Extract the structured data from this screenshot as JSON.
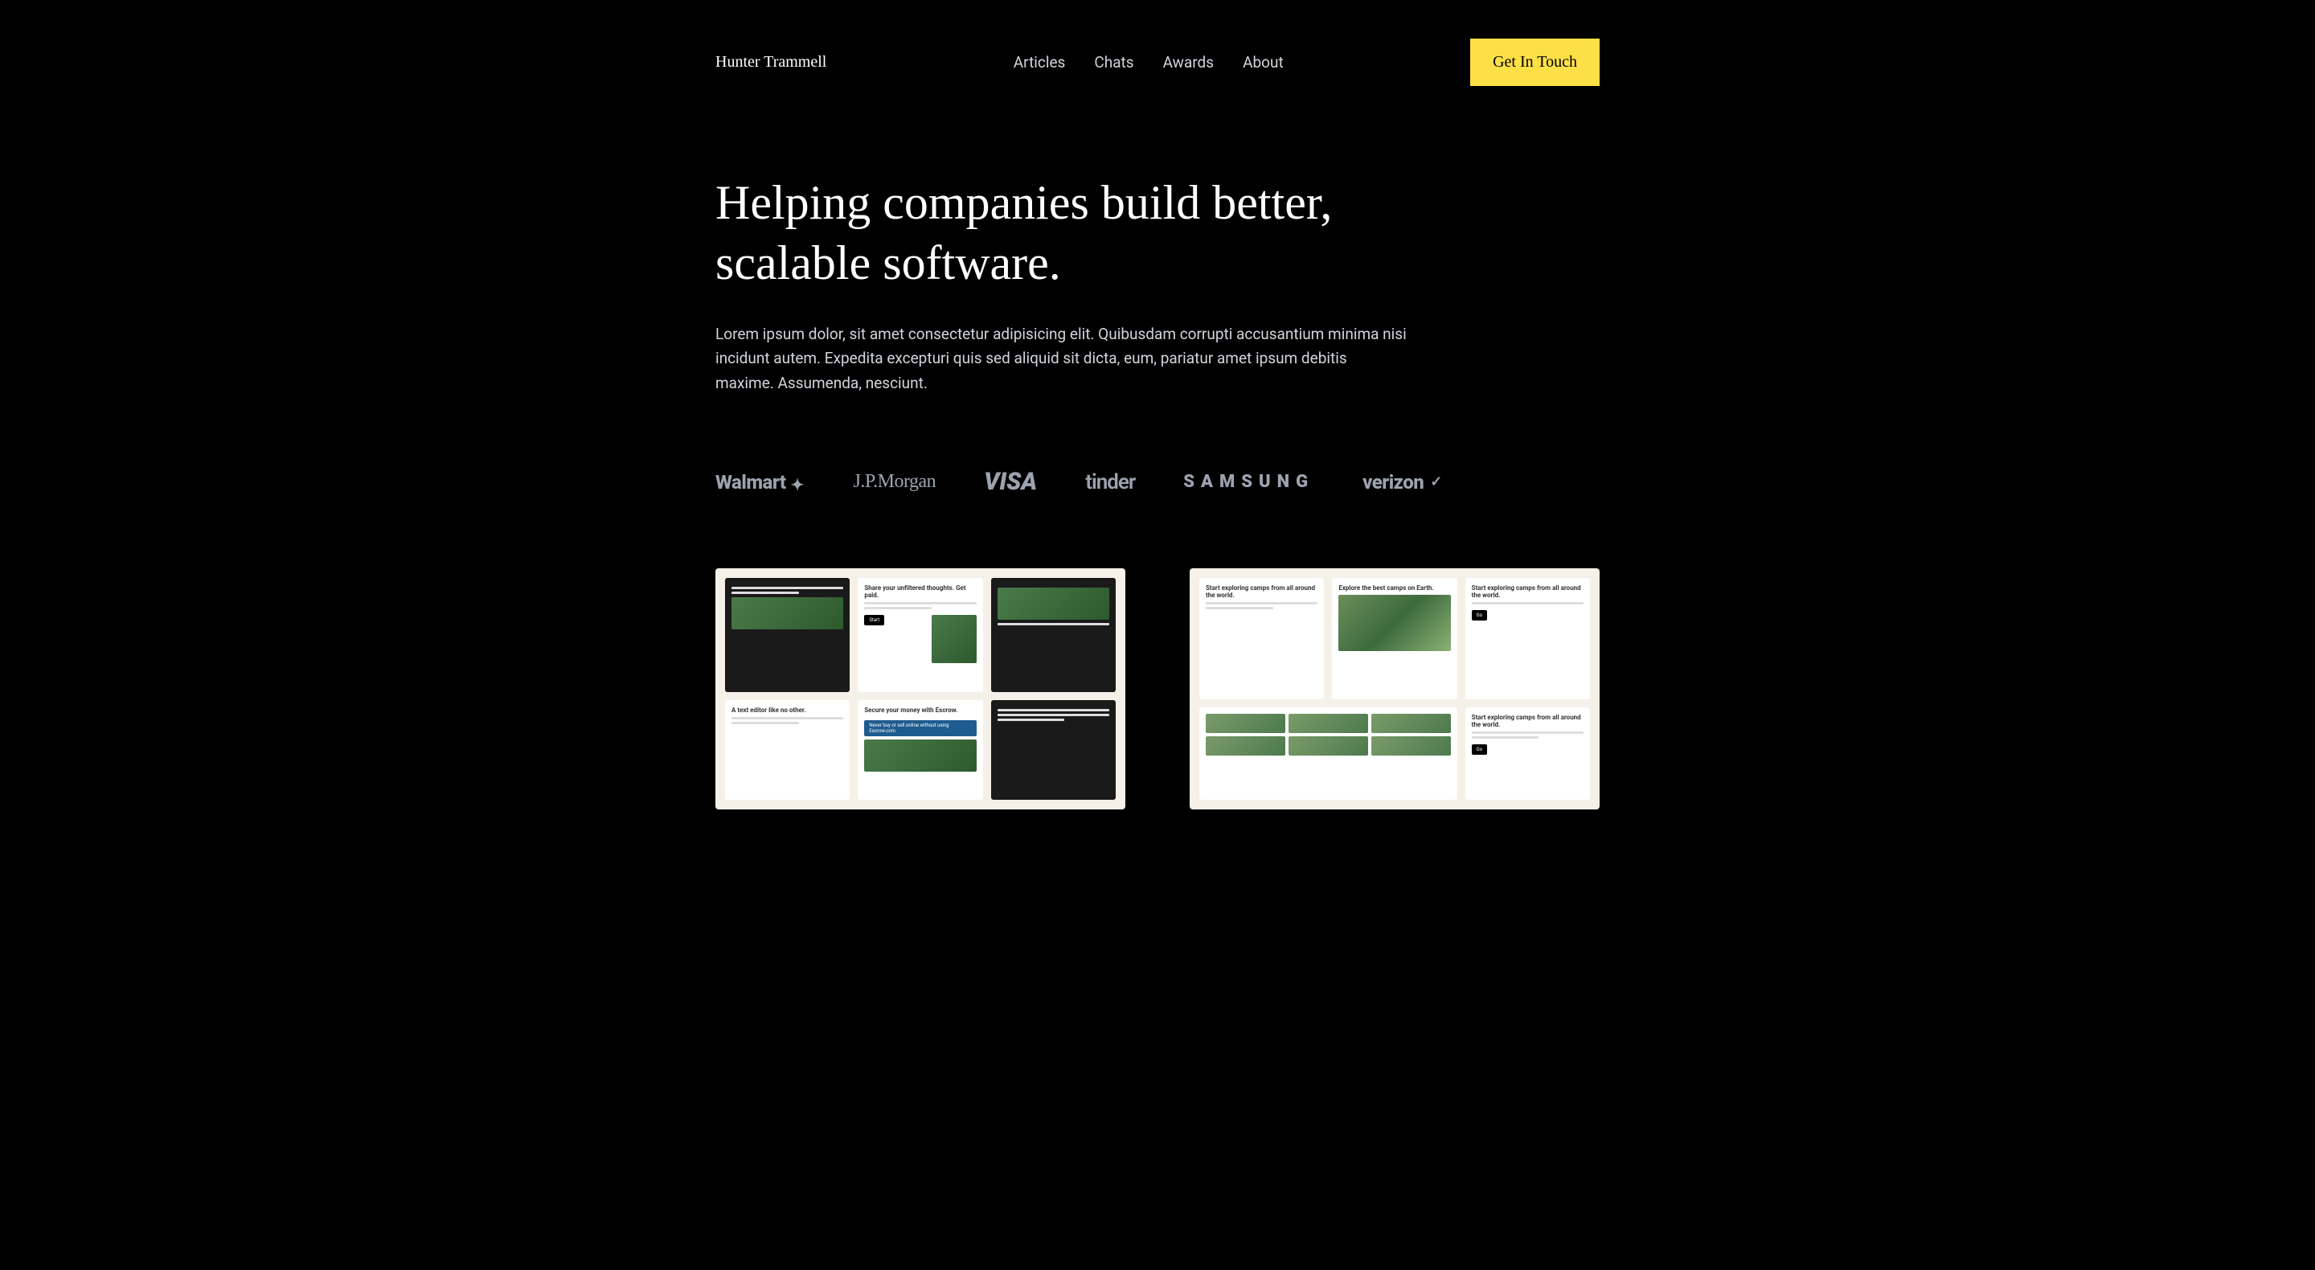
{
  "header": {
    "logo": "Hunter Trammell",
    "nav": {
      "articles": "Articles",
      "chats": "Chats",
      "awards": "Awards",
      "about": "About"
    },
    "cta": "Get In Touch"
  },
  "hero": {
    "title": "Helping companies build better, scalable software.",
    "subtitle": "Lorem ipsum dolor, sit amet consectetur adipisicing elit. Quibusdam corrupti accusantium minima nisi incidunt autem. Expedita excepturi quis sed aliquid sit dicta, eum, pariatur amet ipsum debitis maxime. Assumenda, nesciunt."
  },
  "logos": {
    "walmart": "Walmart",
    "jpmorgan": "J.P.Morgan",
    "visa": "VISA",
    "tinder": "tinder",
    "samsung": "SAMSUNG",
    "verizon": "verizon"
  },
  "portfolio": {
    "card1": {
      "panel1_title": "Share your unfiltered thoughts. Get paid.",
      "panel2_title": "A text editor like no other.",
      "panel3_title": "Secure your money with Escrow.",
      "panel4_title": "Never buy or sell online without using Escrow.com"
    },
    "card2": {
      "panel1_title": "Start exploring camps from all around the world.",
      "panel2_title": "Explore the best camps on Earth.",
      "panel3_title": "Start exploring camps from all around the world."
    }
  }
}
